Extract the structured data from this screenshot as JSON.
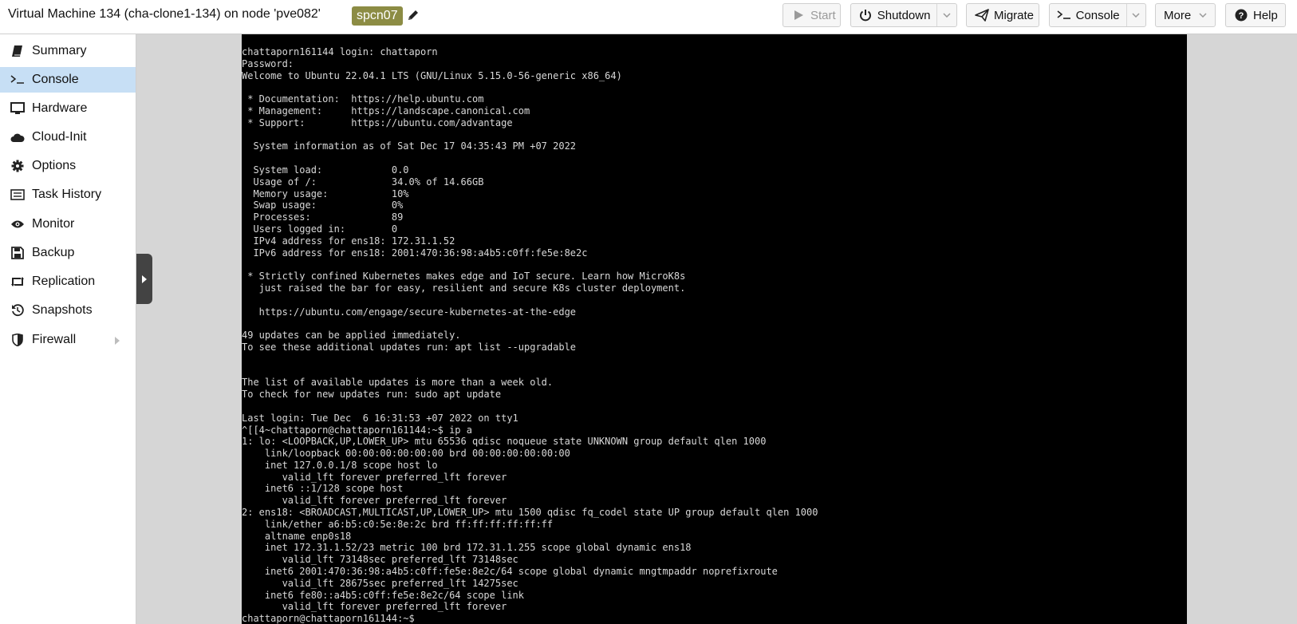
{
  "header": {
    "title": "Virtual Machine 134 (cha-clone1-134) on node 'pve082'",
    "tag": "spcn07",
    "buttons": {
      "start": "Start",
      "shutdown": "Shutdown",
      "migrate": "Migrate",
      "console": "Console",
      "more": "More",
      "help": "Help"
    }
  },
  "sidebar": {
    "items": [
      {
        "label": "Summary",
        "icon": "book-icon"
      },
      {
        "label": "Console",
        "icon": "terminal-icon",
        "active": true
      },
      {
        "label": "Hardware",
        "icon": "monitor-icon"
      },
      {
        "label": "Cloud-Init",
        "icon": "cloud-icon"
      },
      {
        "label": "Options",
        "icon": "gear-icon"
      },
      {
        "label": "Task History",
        "icon": "list-icon"
      },
      {
        "label": "Monitor",
        "icon": "eye-icon"
      },
      {
        "label": "Backup",
        "icon": "floppy-icon"
      },
      {
        "label": "Replication",
        "icon": "retweet-icon"
      },
      {
        "label": "Snapshots",
        "icon": "history-icon"
      },
      {
        "label": "Firewall",
        "icon": "shield-icon"
      }
    ]
  },
  "colors": {
    "tag_bg": "#8c8c44",
    "active_nav": "#c7dff5",
    "terminal_bg": "#000000",
    "terminal_fg": "#d8d8d8"
  },
  "terminal": {
    "lines": [
      "chattaporn161144 login: chattaporn",
      "Password:",
      "Welcome to Ubuntu 22.04.1 LTS (GNU/Linux 5.15.0-56-generic x86_64)",
      "",
      " * Documentation:  https://help.ubuntu.com",
      " * Management:     https://landscape.canonical.com",
      " * Support:        https://ubuntu.com/advantage",
      "",
      "  System information as of Sat Dec 17 04:35:43 PM +07 2022",
      "",
      "  System load:            0.0",
      "  Usage of /:             34.0% of 14.66GB",
      "  Memory usage:           10%",
      "  Swap usage:             0%",
      "  Processes:              89",
      "  Users logged in:        0",
      "  IPv4 address for ens18: 172.31.1.52",
      "  IPv6 address for ens18: 2001:470:36:98:a4b5:c0ff:fe5e:8e2c",
      "",
      " * Strictly confined Kubernetes makes edge and IoT secure. Learn how MicroK8s",
      "   just raised the bar for easy, resilient and secure K8s cluster deployment.",
      "",
      "   https://ubuntu.com/engage/secure-kubernetes-at-the-edge",
      "",
      "49 updates can be applied immediately.",
      "To see these additional updates run: apt list --upgradable",
      "",
      "",
      "The list of available updates is more than a week old.",
      "To check for new updates run: sudo apt update",
      "",
      "Last login: Tue Dec  6 16:31:53 +07 2022 on tty1",
      "^[[4~chattaporn@chattaporn161144:~$ ip a",
      "1: lo: <LOOPBACK,UP,LOWER_UP> mtu 65536 qdisc noqueue state UNKNOWN group default qlen 1000",
      "    link/loopback 00:00:00:00:00:00 brd 00:00:00:00:00:00",
      "    inet 127.0.0.1/8 scope host lo",
      "       valid_lft forever preferred_lft forever",
      "    inet6 ::1/128 scope host",
      "       valid_lft forever preferred_lft forever",
      "2: ens18: <BROADCAST,MULTICAST,UP,LOWER_UP> mtu 1500 qdisc fq_codel state UP group default qlen 1000",
      "    link/ether a6:b5:c0:5e:8e:2c brd ff:ff:ff:ff:ff:ff",
      "    altname enp0s18",
      "    inet 172.31.1.52/23 metric 100 brd 172.31.1.255 scope global dynamic ens18",
      "       valid_lft 73148sec preferred_lft 73148sec",
      "    inet6 2001:470:36:98:a4b5:c0ff:fe5e:8e2c/64 scope global dynamic mngtmpaddr noprefixroute",
      "       valid_lft 28675sec preferred_lft 14275sec",
      "    inet6 fe80::a4b5:c0ff:fe5e:8e2c/64 scope link",
      "       valid_lft forever preferred_lft forever",
      "chattaporn@chattaporn161144:~$"
    ]
  }
}
